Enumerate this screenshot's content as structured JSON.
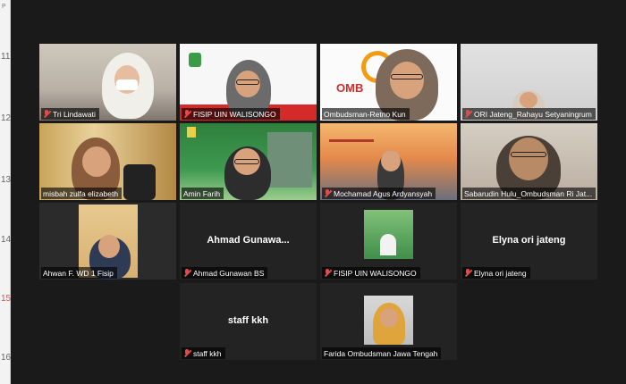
{
  "calendar_strip": {
    "top_mark": "P",
    "hours": [
      "11",
      "12",
      "13",
      "14",
      "15",
      "16"
    ]
  },
  "participants": [
    {
      "name": "Tri Lindawati",
      "video": true,
      "muted": true
    },
    {
      "name": "FISIP UIN WALISONGO",
      "video": true,
      "muted": true
    },
    {
      "name": "Ombudsman-Retno Kun",
      "video": true,
      "muted": false
    },
    {
      "name": "ORI Jateng_Rahayu Setyaningrum",
      "video": true,
      "muted": true
    },
    {
      "name": "misbah zulfa elizabeth",
      "video": true,
      "muted": false
    },
    {
      "name": "Amin Farih",
      "video": true,
      "muted": false
    },
    {
      "name": "Mochamad Agus Ardyansyah",
      "video": true,
      "muted": true
    },
    {
      "name": "Sabarudin Hulu_Ombudsman Ri Jat...",
      "video": true,
      "muted": false
    },
    {
      "name": "Ahwan F. WD 1 Fisip",
      "video": true,
      "muted": false,
      "active_speaker": true
    },
    {
      "name": "Ahmad Gunawan BS",
      "video": false,
      "display_name": "Ahmad  Gunawa...",
      "muted": true
    },
    {
      "name": "FISIP UIN WALISONGO",
      "video": true,
      "muted": true
    },
    {
      "name": "Elyna ori jateng",
      "video": false,
      "display_name": "Elyna ori jateng",
      "muted": true
    },
    {
      "name": "staff kkh",
      "video": false,
      "display_name": "staff kkh",
      "muted": true
    },
    {
      "name": "Farida Ombudsman Jawa Tengah",
      "video": true,
      "muted": false
    }
  ],
  "colors": {
    "active_border": "#e4e44a",
    "muted_mic": "#e04b4b",
    "background": "#1a1a1a"
  }
}
